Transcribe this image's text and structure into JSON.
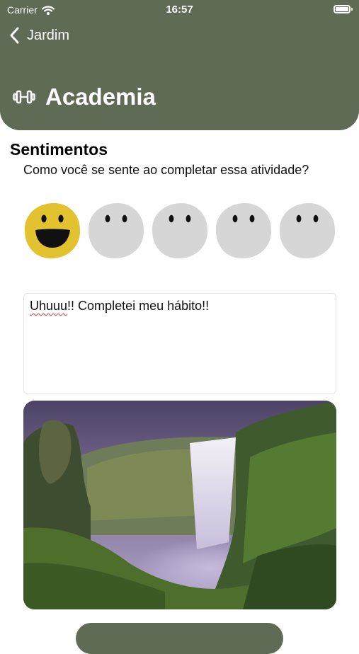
{
  "status_bar": {
    "carrier": "Carrier",
    "time": "16:57"
  },
  "nav": {
    "back_label": "Jardim"
  },
  "header": {
    "title": "Academia",
    "icon": "dumbbell-icon"
  },
  "feelings": {
    "title": "Sentimentos",
    "question": "Como você se sente ao completar essa atividade?",
    "options": [
      {
        "name": "happy",
        "selected": true,
        "color": "#e3c22f"
      },
      {
        "name": "mood-2",
        "selected": false,
        "color": "#d6d6d6"
      },
      {
        "name": "mood-3",
        "selected": false,
        "color": "#d6d6d6"
      },
      {
        "name": "mood-4",
        "selected": false,
        "color": "#d6d6d6"
      },
      {
        "name": "mood-5",
        "selected": false,
        "color": "#d6d6d6"
      }
    ]
  },
  "note": {
    "misspelled_word": "Uhuuu",
    "rest": "!! Completei meu hábito!!"
  },
  "colors": {
    "header": "#5f6b55",
    "selected_mood": "#e3c22f",
    "unselected_mood": "#d6d6d6"
  }
}
